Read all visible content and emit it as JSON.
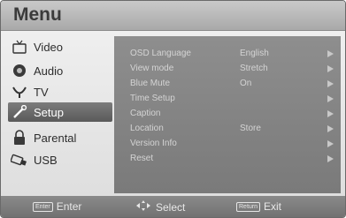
{
  "title": "Menu",
  "sidebar": {
    "items": [
      {
        "label": "Video",
        "icon": "tv-icon"
      },
      {
        "label": "Audio",
        "icon": "speaker-icon"
      },
      {
        "label": "TV",
        "icon": "antenna-icon"
      },
      {
        "label": "Setup",
        "icon": "wrench-icon",
        "selected": true
      },
      {
        "label": "Parental",
        "icon": "lock-icon"
      },
      {
        "label": "USB",
        "icon": "usb-icon"
      }
    ]
  },
  "settings": {
    "rows": [
      {
        "label": "OSD Language",
        "value": "English"
      },
      {
        "label": "View mode",
        "value": "Stretch"
      },
      {
        "label": "Blue Mute",
        "value": "On"
      },
      {
        "label": "Time Setup",
        "value": ""
      },
      {
        "label": "Caption",
        "value": ""
      },
      {
        "label": "Location",
        "value": "Store"
      },
      {
        "label": "Version Info",
        "value": ""
      },
      {
        "label": "Reset",
        "value": ""
      }
    ]
  },
  "footer": {
    "enter_key": "Enter",
    "enter_label": "Enter",
    "select_label": "Select",
    "return_key": "Return",
    "return_label": "Exit"
  }
}
